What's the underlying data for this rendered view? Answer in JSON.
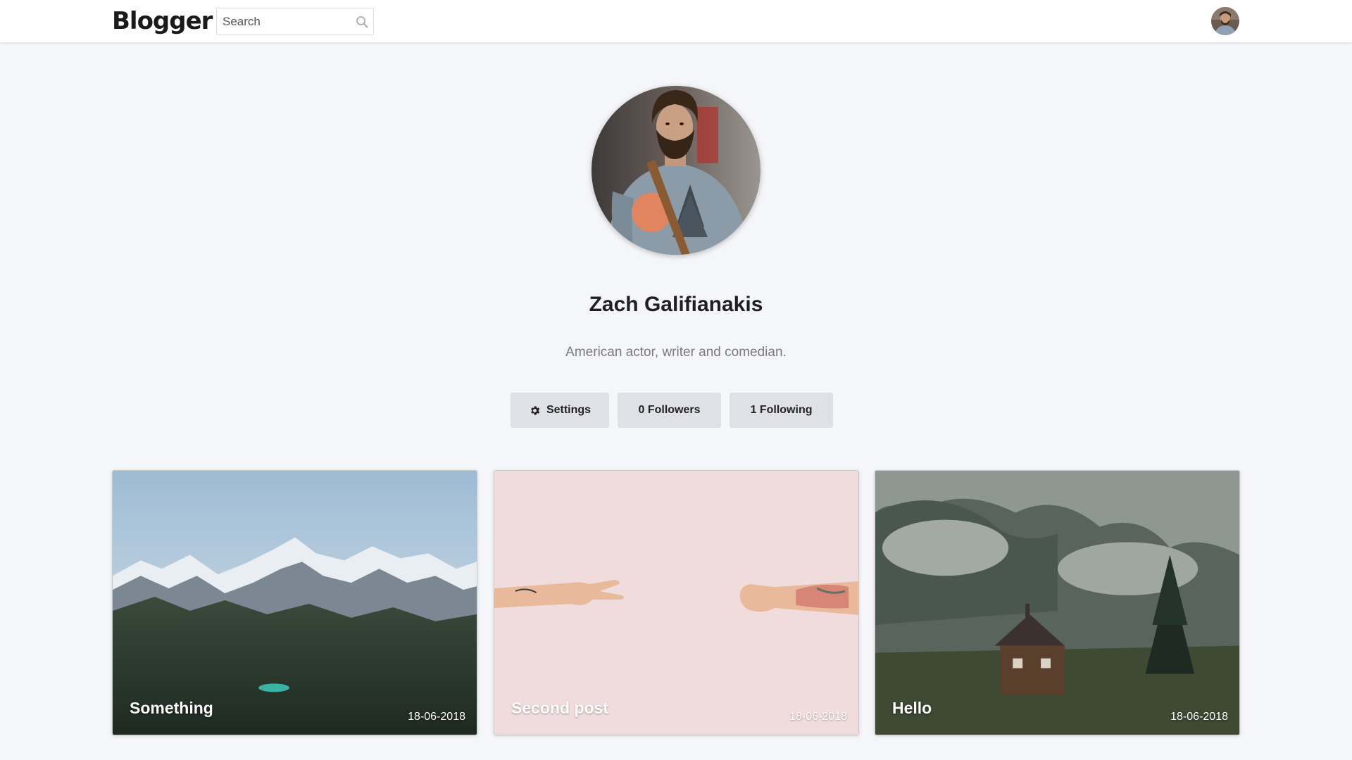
{
  "header": {
    "logo": "Blogger",
    "search": {
      "placeholder": "Search",
      "value": ""
    },
    "search_icon": "search-icon",
    "avatar_icon": "user-avatar"
  },
  "profile": {
    "name": "Zach Galifianakis",
    "bio": "American actor, writer and comedian."
  },
  "actions": {
    "settings_label": "Settings",
    "settings_icon": "gear-icon",
    "followers_label": "0 Followers",
    "following_label": "1 Following"
  },
  "posts": [
    {
      "title": "Something",
      "date": "18-06-2018"
    },
    {
      "title": "Second post",
      "date": "18-06-2018"
    },
    {
      "title": "Hello",
      "date": "18-06-2018"
    }
  ],
  "colors": {
    "page_background": "#f5f6fa",
    "header_background": "#ffffff",
    "button_background": "#dfe1e6",
    "bio_text": "#7a7a7a"
  }
}
